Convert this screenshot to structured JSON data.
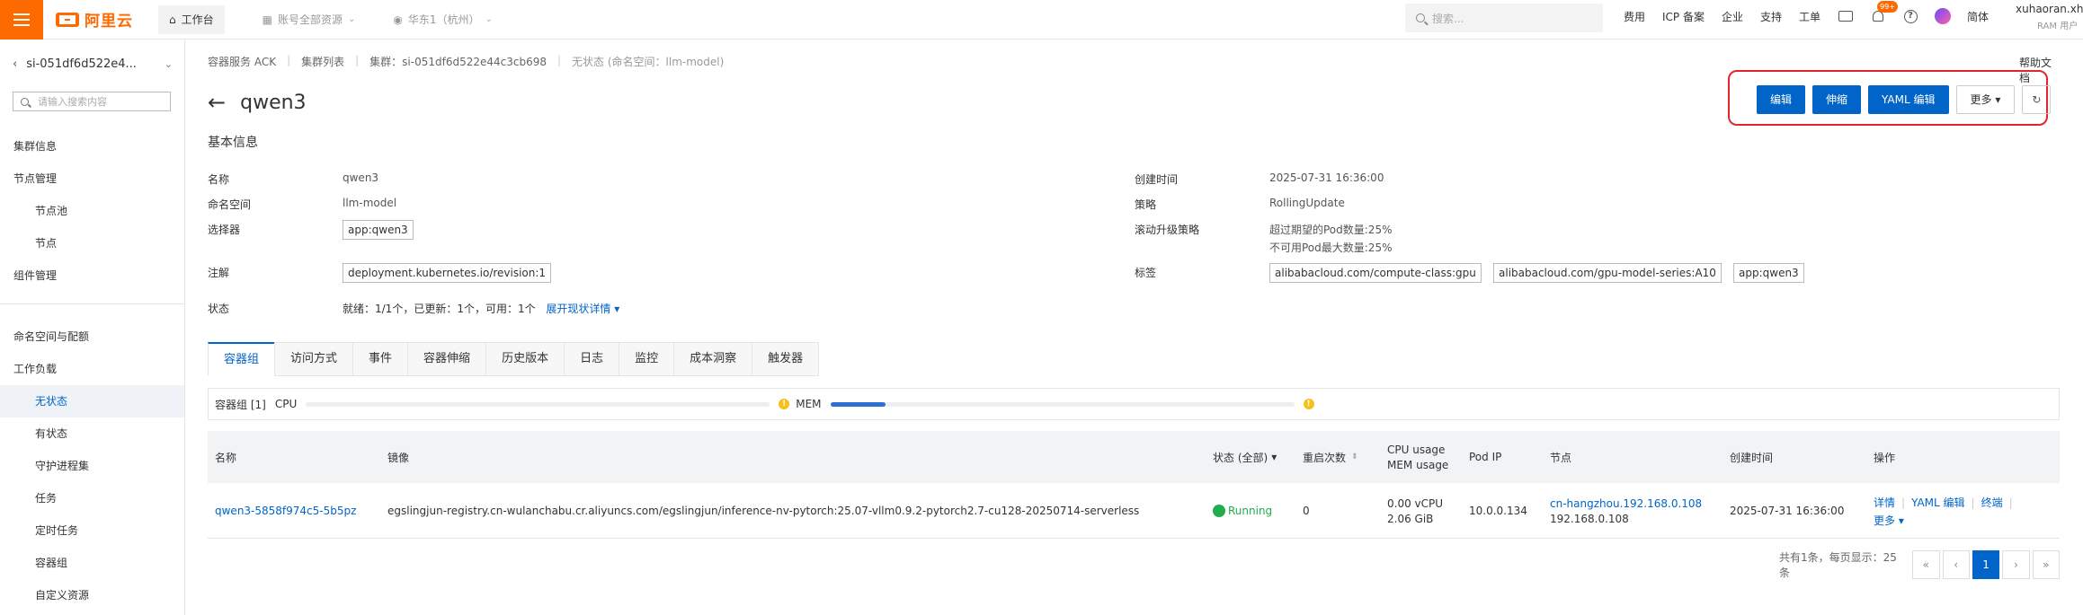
{
  "topbar": {
    "logo": "阿里云",
    "workbench": "工作台",
    "account": "账号全部资源",
    "region": "华东1（杭州）",
    "search_placeholder": "搜索...",
    "links": [
      "费用",
      "ICP 备案",
      "企业",
      "支持",
      "工单"
    ],
    "notify_badge": "99+",
    "lang": "简体",
    "user_name": "xuhaoran.xh...",
    "user_role": "RAM 用户"
  },
  "sidebar": {
    "cluster_name": "si-051df6d522e4...",
    "search_placeholder": "请输入搜索内容",
    "items": [
      "集群信息",
      "节点管理",
      "节点池",
      "节点",
      "组件管理",
      "命名空间与配额",
      "工作负载",
      "无状态",
      "有状态",
      "守护进程集",
      "任务",
      "定时任务",
      "容器组",
      "自定义资源"
    ]
  },
  "breadcrumb": [
    "容器服务 ACK",
    "集群列表",
    "集群：si-051df6d522e44c3cb698",
    "无状态 (命名空间：llm-model)"
  ],
  "help_doc": "帮助文档",
  "page_title": "qwen3",
  "actions": {
    "edit": "编辑",
    "scale": "伸缩",
    "yaml_edit": "YAML 编辑",
    "more": "更多"
  },
  "basic_info": {
    "title": "基本信息",
    "name_label": "名称",
    "name_value": "qwen3",
    "namespace_label": "命名空间",
    "namespace_value": "llm-model",
    "selector_label": "选择器",
    "selector_value": "app:qwen3",
    "annotation_label": "注解",
    "annotation_value": "deployment.kubernetes.io/revision:1",
    "status_label": "状态",
    "status_value": "就绪：1/1个，已更新：1个，可用：1个",
    "status_link": "展开现状详情",
    "created_label": "创建时间",
    "created_value": "2025-07-31 16:36:00",
    "strategy_label": "策略",
    "strategy_value": "RollingUpdate",
    "rolling_label": "滚动升级策略",
    "rolling_line1": "超过期望的Pod数量:25%",
    "rolling_line2": "不可用Pod最大数量:25%",
    "labels_label": "标签",
    "labels": [
      "alibabacloud.com/compute-class:gpu",
      "alibabacloud.com/gpu-model-series:A10",
      "app:qwen3"
    ]
  },
  "tabs": [
    "容器组",
    "访问方式",
    "事件",
    "容器伸缩",
    "历史版本",
    "日志",
    "监控",
    "成本洞察",
    "触发器"
  ],
  "metrics": {
    "group_label": "容器组 [1]",
    "cpu_label": "CPU",
    "cpu_fraction": 0.0,
    "mem_label": "MEM",
    "mem_fraction": 0.12
  },
  "table": {
    "headers": {
      "name": "名称",
      "image": "镜像",
      "status": "状态 (全部)",
      "restarts": "重启次数",
      "usage1": "CPU usage",
      "usage2": "MEM usage",
      "pod_ip": "Pod IP",
      "node": "节点",
      "created": "创建时间",
      "ops": "操作"
    },
    "row": {
      "name": "qwen3-5858f974c5-5b5pz",
      "image": "egslingjun-registry.cn-wulanchabu.cr.aliyuncs.com/egslingjun/inference-nv-pytorch:25.07-vllm0.9.2-pytorch2.7-cu128-20250714-serverless",
      "status": "Running",
      "restarts": "0",
      "cpu": "0.00 vCPU",
      "mem": "2.06 GiB",
      "pod_ip": "10.0.0.134",
      "node_link": "cn-hangzhou.192.168.0.108",
      "node_ip": "192.168.0.108",
      "created": "2025-07-31 16:36:00",
      "op_detail": "详情",
      "op_yaml": "YAML 编辑",
      "op_terminal": "终端",
      "op_more": "更多"
    }
  },
  "pager": {
    "summary": "共有1条，每页显示：25条",
    "first": "«",
    "prev": "‹",
    "current": "1",
    "next": "›",
    "last": "»"
  }
}
